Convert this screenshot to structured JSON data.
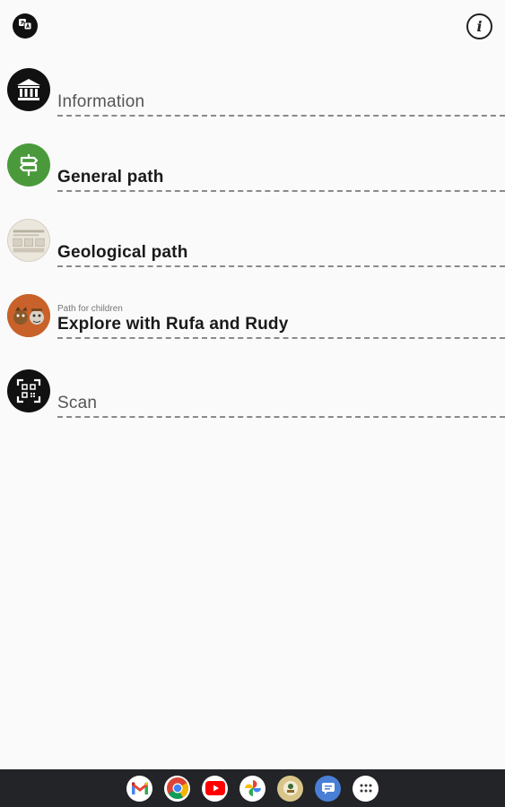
{
  "header": {
    "language_icon": "translate-icon",
    "info_icon": "info-icon",
    "info_glyph": "i"
  },
  "menu": {
    "items": [
      {
        "label": "Information",
        "sublabel": "",
        "icon": "museum-icon",
        "icon_bg": "#111111",
        "style": "light"
      },
      {
        "label": "General path",
        "sublabel": "",
        "icon": "signpost-icon",
        "icon_bg": "#4a9a3c",
        "style": "bold"
      },
      {
        "label": "Geological path",
        "sublabel": "",
        "icon": "geology-map-thumbnail",
        "icon_bg": "#e6e2d8",
        "style": "bold"
      },
      {
        "label": "Explore with Rufa and Rudy",
        "sublabel": "Path for children",
        "icon": "children-characters-thumbnail",
        "icon_bg": "#c8622a",
        "style": "bold"
      },
      {
        "label": "Scan",
        "sublabel": "",
        "icon": "qr-scan-icon",
        "icon_bg": "#111111",
        "style": "light"
      }
    ]
  },
  "taskbar": {
    "apps": [
      "gmail-icon",
      "chrome-icon",
      "youtube-icon",
      "photos-icon",
      "app-icon",
      "messages-icon",
      "app-launcher-icon"
    ]
  },
  "colors": {
    "background": "#fafafa",
    "divider": "#8a8a8a",
    "taskbar": "#222427"
  }
}
